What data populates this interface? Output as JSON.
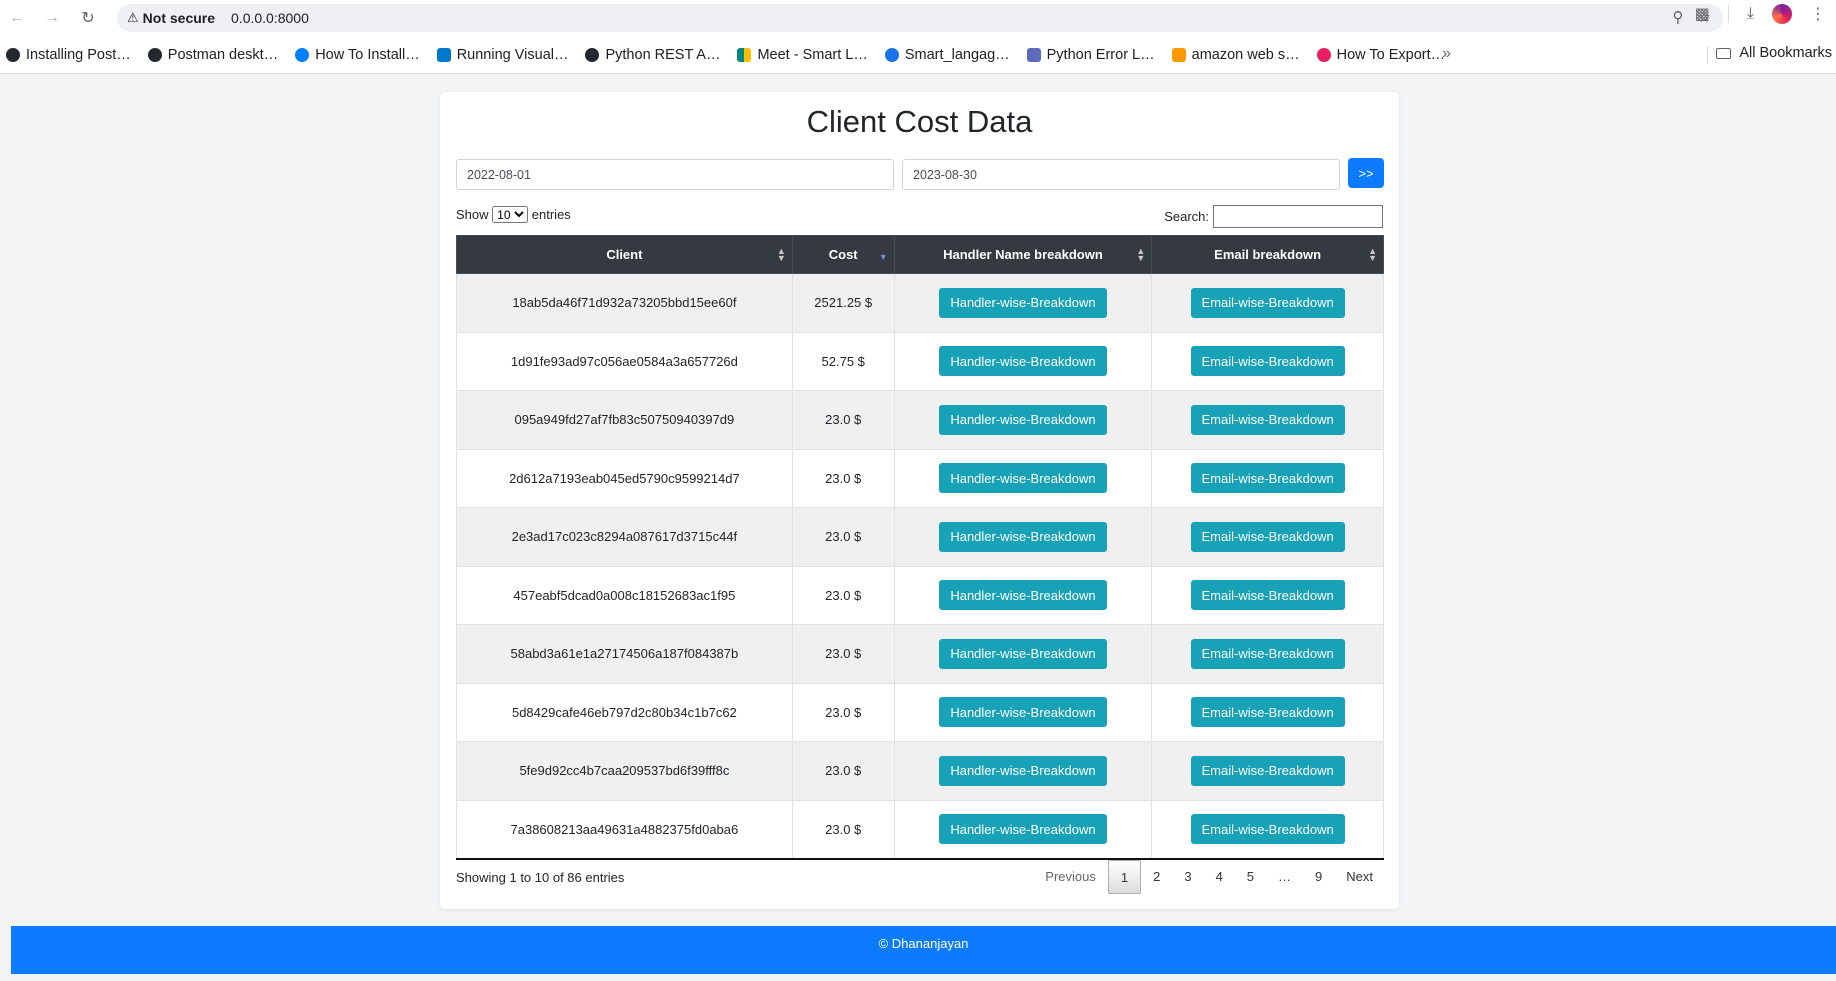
{
  "browser": {
    "security_label": "Not secure",
    "url": "0.0.0.0:8000",
    "bookmarks": [
      {
        "label": "Installing Post…",
        "color": "#24292f"
      },
      {
        "label": "Postman deskt…",
        "color": "#24292f"
      },
      {
        "label": "How To Install…",
        "color": "#0080ff"
      },
      {
        "label": "Running Visual…",
        "color": "#007acc"
      },
      {
        "label": "Python REST A…",
        "color": "#24292f"
      },
      {
        "label": "Meet - Smart L…",
        "color": "#00897b"
      },
      {
        "label": "Smart_langag…",
        "color": "#1a73e8"
      },
      {
        "label": "Python Error L…",
        "color": "#5c6bc0"
      },
      {
        "label": "amazon web s…",
        "color": "#ff9900"
      },
      {
        "label": "How To Export…",
        "color": "#e91e63"
      }
    ],
    "all_bookmarks": "All Bookmarks"
  },
  "page": {
    "title": "Client Cost Data",
    "start_date": "2022-08-01",
    "end_date": "2023-08-30",
    "go_label": ">>",
    "show_label": "Show",
    "entries_option": "10",
    "entries_label": "entries",
    "search_label": "Search:",
    "search_value": ""
  },
  "table": {
    "headers": [
      "Client",
      "Cost",
      "Handler Name breakdown",
      "Email breakdown"
    ],
    "rows": [
      {
        "client": "18ab5da46f71d932a73205bbd15ee60f",
        "cost": "2521.25 $",
        "handler": "Handler-wise-Breakdown",
        "email": "Email-wise-Breakdown"
      },
      {
        "client": "1d91fe93ad97c056ae0584a3a657726d",
        "cost": "52.75 $",
        "handler": "Handler-wise-Breakdown",
        "email": "Email-wise-Breakdown"
      },
      {
        "client": "095a949fd27af7fb83c50750940397d9",
        "cost": "23.0 $",
        "handler": "Handler-wise-Breakdown",
        "email": "Email-wise-Breakdown"
      },
      {
        "client": "2d612a7193eab045ed5790c9599214d7",
        "cost": "23.0 $",
        "handler": "Handler-wise-Breakdown",
        "email": "Email-wise-Breakdown"
      },
      {
        "client": "2e3ad17c023c8294a087617d3715c44f",
        "cost": "23.0 $",
        "handler": "Handler-wise-Breakdown",
        "email": "Email-wise-Breakdown"
      },
      {
        "client": "457eabf5dcad0a008c18152683ac1f95",
        "cost": "23.0 $",
        "handler": "Handler-wise-Breakdown",
        "email": "Email-wise-Breakdown"
      },
      {
        "client": "58abd3a61e1a27174506a187f084387b",
        "cost": "23.0 $",
        "handler": "Handler-wise-Breakdown",
        "email": "Email-wise-Breakdown"
      },
      {
        "client": "5d8429cafe46eb797d2c80b34c1b7c62",
        "cost": "23.0 $",
        "handler": "Handler-wise-Breakdown",
        "email": "Email-wise-Breakdown"
      },
      {
        "client": "5fe9d92cc4b7caa209537bd6f39fff8c",
        "cost": "23.0 $",
        "handler": "Handler-wise-Breakdown",
        "email": "Email-wise-Breakdown"
      },
      {
        "client": "7a38608213aa49631a4882375fd0aba6",
        "cost": "23.0 $",
        "handler": "Handler-wise-Breakdown",
        "email": "Email-wise-Breakdown"
      }
    ]
  },
  "pagination": {
    "info": "Showing 1 to 10 of 86 entries",
    "previous": "Previous",
    "pages": [
      "1",
      "2",
      "3",
      "4",
      "5",
      "…",
      "9"
    ],
    "next": "Next",
    "active_page": "1"
  },
  "footer": {
    "text": "© Dhananjayan"
  },
  "colors": {
    "accent": "#0d7bfd",
    "button_teal": "#17a2b8",
    "table_header": "#343a40"
  }
}
